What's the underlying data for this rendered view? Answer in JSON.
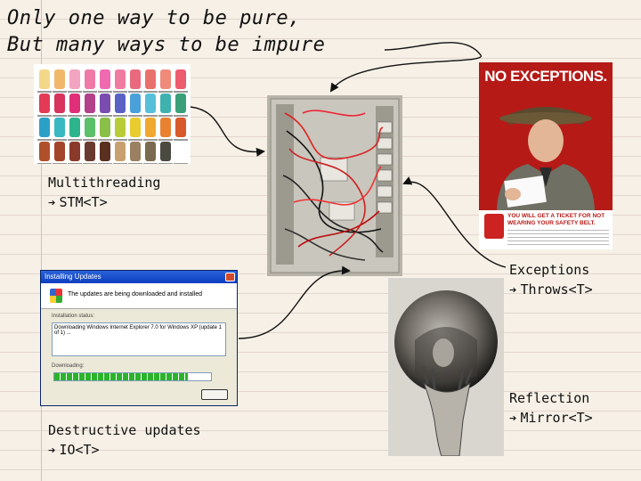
{
  "title": {
    "line1": "Only one way to be pure,",
    "line2": "But many ways to be impure"
  },
  "captions": {
    "multithreading": {
      "label": "Multithreading",
      "type": "STM<T>"
    },
    "exceptions": {
      "label": "Exceptions",
      "type": "Throws<T>"
    },
    "destructive": {
      "label": "Destructive updates",
      "type": "IO<T>"
    },
    "reflection": {
      "label": "Reflection",
      "type": "Mirror<T>"
    }
  },
  "arrow_glyph": "➔",
  "poster": {
    "headline": "NO EXCEPTIONS.",
    "ticket_text": "YOU WILL GET A TICKET FOR NOT WEARING YOUR SAFETY BELT."
  },
  "dialog": {
    "title": "Installing Updates",
    "header_text": "The updates are being downloaded and installed",
    "status_label": "Installation status:",
    "status_text": "Downloading Windows Internet Explorer 7.0 for Windows XP (update 1 of 1) ...",
    "progress_label": "Downloading:",
    "progress_percent": 85
  },
  "colors": {
    "paper": "#f6f0e6",
    "rule_line": "#e3d6cf",
    "poster_red": "#b51a17"
  }
}
